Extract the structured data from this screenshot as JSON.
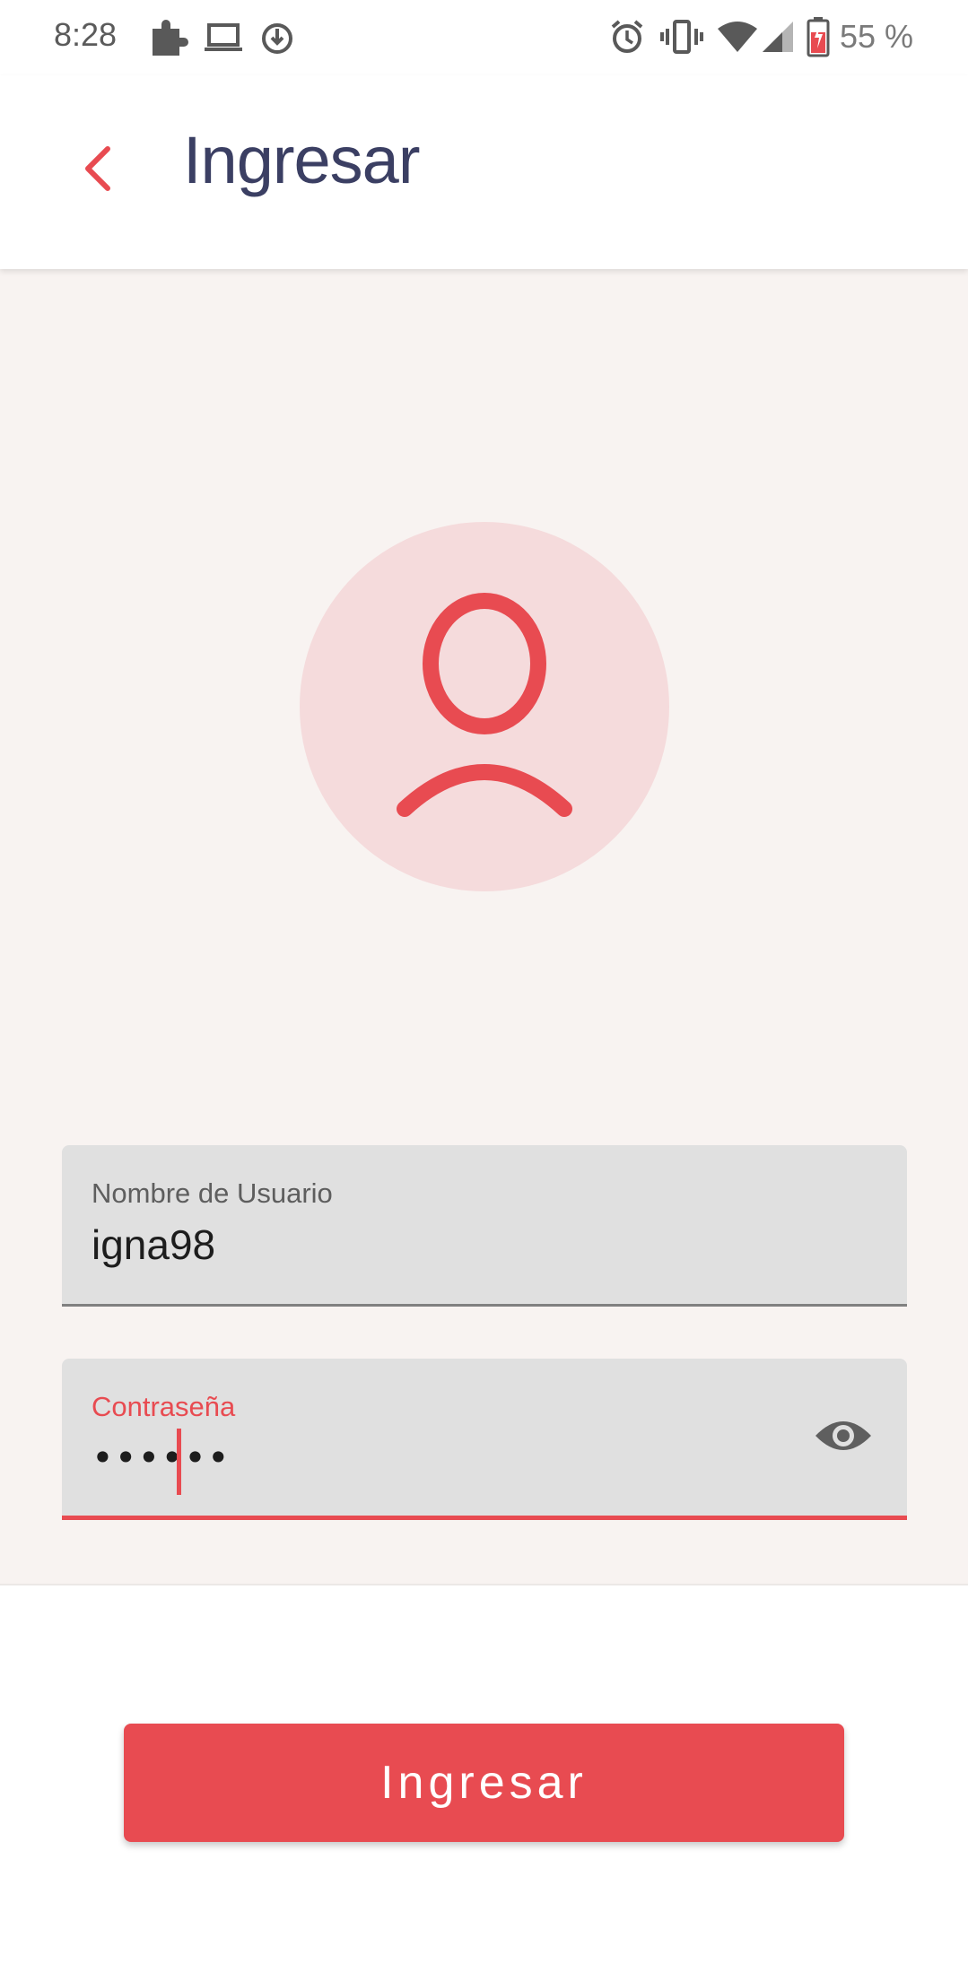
{
  "status_bar": {
    "time": "8:28",
    "battery_percent": "55 %",
    "icons": [
      "puzzle-icon",
      "laptop-icon",
      "sync-icon",
      "alarm-icon",
      "vibrate-icon",
      "wifi-icon",
      "signal-icon",
      "battery-icon"
    ]
  },
  "app_bar": {
    "back_icon": "chevron-left-icon",
    "title": "Ingresar"
  },
  "avatar": {
    "icon": "user-icon"
  },
  "form": {
    "username": {
      "label": "Nombre de Usuario",
      "value": "igna98"
    },
    "password": {
      "label": "Contraseña",
      "masked_value": "••••••",
      "toggle_icon": "eye-icon"
    }
  },
  "submit_button": {
    "label": "Ingresar"
  },
  "colors": {
    "accent": "#e84b51",
    "title": "#3b3f63",
    "background": "#f8f3f1",
    "avatar_bg": "#f5dbdc",
    "field_bg": "#e0e0e0"
  }
}
